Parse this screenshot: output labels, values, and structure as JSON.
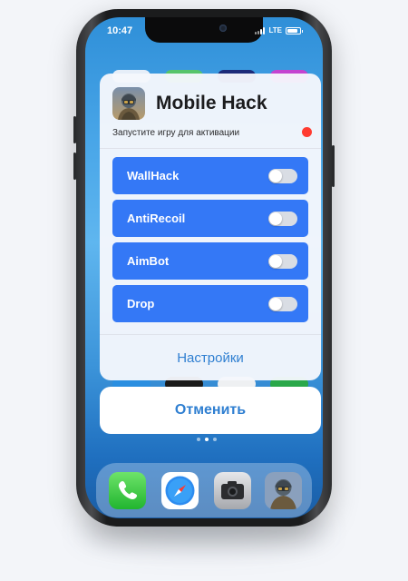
{
  "status_bar": {
    "time": "10:47",
    "network": "LTE",
    "battery_level": 0.85
  },
  "panel": {
    "title": "Mobile Hack",
    "subtitle": "Запустите игру для активации",
    "status_color": "#ff3b30",
    "game_icon": "game-character-icon",
    "toggles": [
      {
        "label": "WallHack",
        "on": false
      },
      {
        "label": "AntiRecoil",
        "on": false
      },
      {
        "label": "AimBot",
        "on": false
      },
      {
        "label": "Drop",
        "on": false
      }
    ],
    "settings_label": "Настройки"
  },
  "cancel_label": "Отменить",
  "page_indicator": {
    "count": 3,
    "current": 2
  },
  "dock": {
    "apps": [
      {
        "name": "phone-icon"
      },
      {
        "name": "safari-icon"
      },
      {
        "name": "camera-icon"
      },
      {
        "name": "game-icon"
      }
    ]
  },
  "colors": {
    "accent": "#3478f6",
    "link": "#2f7fd1"
  }
}
